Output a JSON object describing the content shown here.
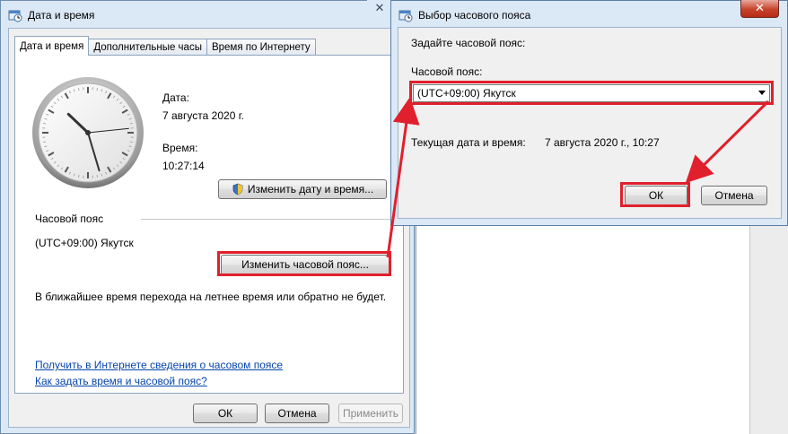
{
  "main_window": {
    "title": "Дата и время",
    "tabs": [
      "Дата и время",
      "Дополнительные часы",
      "Время по Интернету"
    ],
    "date_label": "Дата:",
    "date_value": "7 августа 2020 г.",
    "time_label": "Время:",
    "time_value": "10:27:14",
    "change_datetime_button": "Изменить дату и время...",
    "timezone_label": "Часовой пояс",
    "timezone_value": "(UTC+09:00) Якутск",
    "change_timezone_button": "Изменить часовой пояс...",
    "dst_note": "В ближайшее время перехода на летнее время или обратно не будет.",
    "link_online_info": "Получить в Интернете сведения о часовом поясе",
    "link_howto": "Как задать время и часовой пояс?",
    "ok_button": "ОК",
    "cancel_button": "Отмена",
    "apply_button": "Применить",
    "close_glyph": "✕"
  },
  "dialog": {
    "title": "Выбор часового пояса",
    "prompt": "Задайте часовой пояс:",
    "tz_label": "Часовой пояс:",
    "tz_selected": "(UTC+09:00) Якутск",
    "current_label": "Текущая дата и время:",
    "current_value": "7 августа 2020 г., 10:27",
    "ok_button": "ОК",
    "cancel_button": "Отмена",
    "close_glyph": "✕"
  },
  "clock": {
    "hours": 10,
    "minutes": 27,
    "seconds": 14
  },
  "icons": {
    "window_icon": "clock-window-icon",
    "shield": "uac-shield-icon"
  },
  "colors": {
    "highlight": "#e0202c",
    "link": "#0645ad"
  }
}
